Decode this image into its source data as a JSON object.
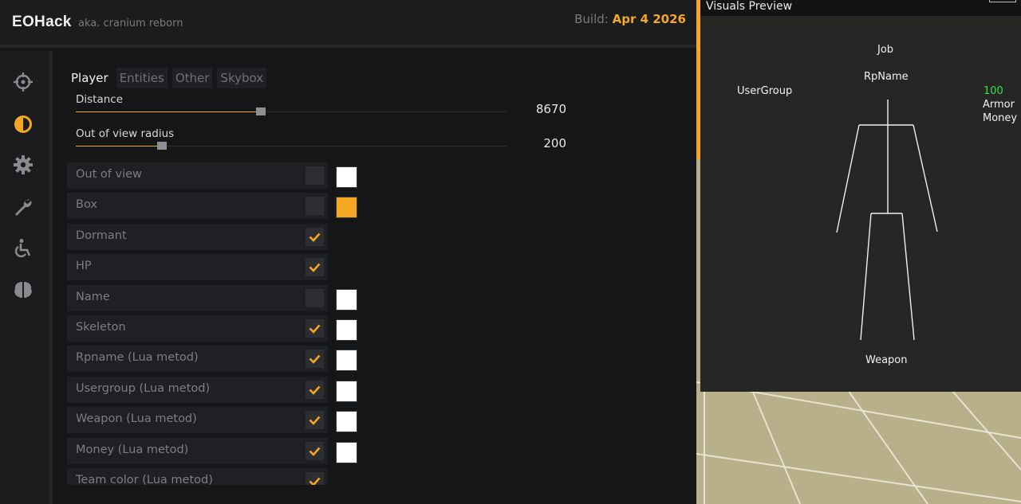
{
  "header": {
    "brand": "EOHack",
    "brand_sub": "aka. cranium reborn",
    "build_label": "Build:",
    "build_date": "Apr  4 2026"
  },
  "colors": {
    "accent": "#f5a623",
    "hp_green": "#38e04a"
  },
  "sidebar": {
    "items": [
      {
        "icon": "crosshair-icon"
      },
      {
        "icon": "half-circle-visuals-icon",
        "active": true
      },
      {
        "icon": "gear-icon"
      },
      {
        "icon": "wrench-icon"
      },
      {
        "icon": "wheelchair-icon"
      },
      {
        "icon": "brain-icon"
      }
    ]
  },
  "tabs": [
    {
      "label": "Player",
      "active": true
    },
    {
      "label": "Entities"
    },
    {
      "label": "Other"
    },
    {
      "label": "Skybox"
    }
  ],
  "sliders": {
    "distance": {
      "label": "Distance",
      "value": "8670",
      "fraction": 0.43
    },
    "out_of_view_radius": {
      "label": "Out of view radius",
      "value": "200",
      "fraction": 0.2
    }
  },
  "options": [
    {
      "label": "Out of view",
      "checked": false,
      "color": "#ffffff"
    },
    {
      "label": "Box",
      "checked": false,
      "color": "#f5a623"
    },
    {
      "label": "Dormant",
      "checked": true,
      "color": null
    },
    {
      "label": "HP",
      "checked": true,
      "color": null
    },
    {
      "label": "Name",
      "checked": false,
      "color": "#ffffff"
    },
    {
      "label": "Skeleton",
      "checked": true,
      "color": "#ffffff"
    },
    {
      "label": "Rpname (Lua metod)",
      "checked": true,
      "color": "#ffffff"
    },
    {
      "label": "Usergroup (Lua metod)",
      "checked": true,
      "color": "#ffffff"
    },
    {
      "label": "Weapon (Lua metod)",
      "checked": true,
      "color": "#ffffff"
    },
    {
      "label": "Money (Lua metod)",
      "checked": true,
      "color": "#ffffff"
    },
    {
      "label": "Team color (Lua metod)",
      "checked": true,
      "color": null
    }
  ],
  "preview": {
    "title": "Visuals Preview",
    "job": "Job",
    "rpname": "RpName",
    "usergroup": "UserGroup",
    "hp": "100",
    "armor": "Armor",
    "money": "Money",
    "weapon": "Weapon"
  }
}
